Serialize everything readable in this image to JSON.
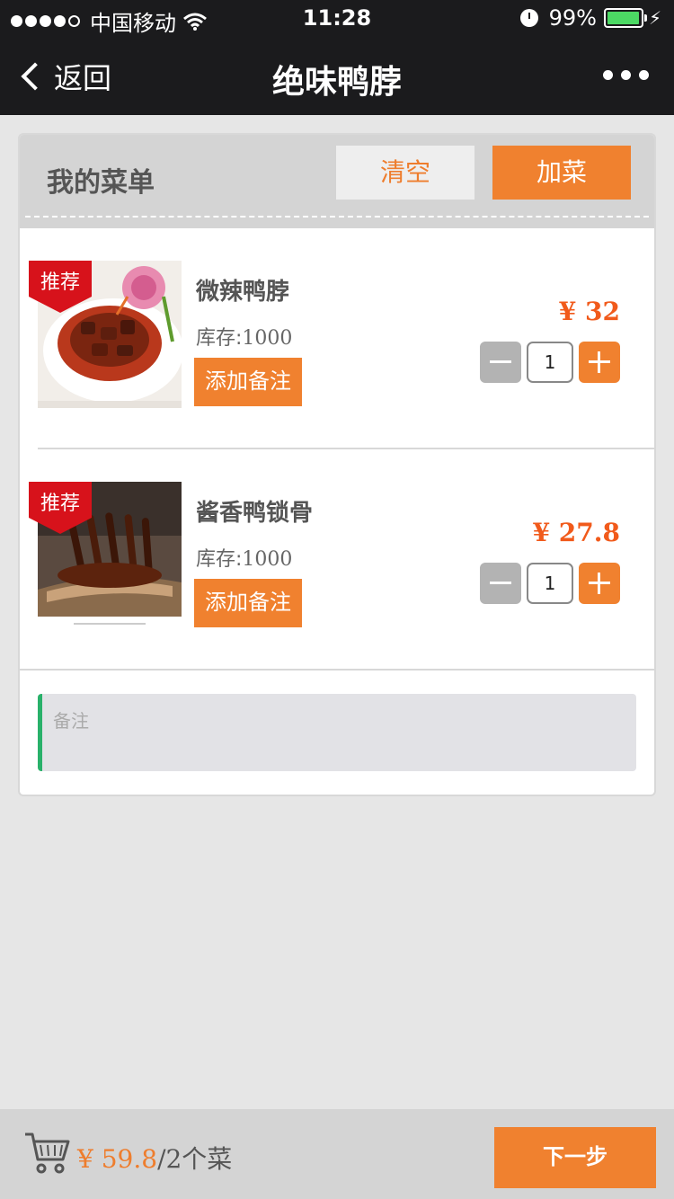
{
  "status_bar": {
    "carrier": "中国移动",
    "time": "11:28",
    "battery": "99%"
  },
  "nav": {
    "back_label": "返回",
    "title": "绝味鸭脖"
  },
  "menu": {
    "title": "我的菜单",
    "clear_label": "清空",
    "add_label": "加菜",
    "items": [
      {
        "badge": "推荐",
        "name": "微辣鸭脖",
        "stock_label": "库存:",
        "stock": "1000",
        "note_button": "添加备注",
        "price": "¥ 32",
        "quantity": "1"
      },
      {
        "badge": "推荐",
        "name": "酱香鸭锁骨",
        "stock_label": "库存:",
        "stock": "1000",
        "note_button": "添加备注",
        "price": "¥ 27.8",
        "quantity": "1"
      }
    ],
    "remark_placeholder": "备注"
  },
  "footer": {
    "total_amount": "¥ 59.8",
    "count_text": "/2个菜",
    "next_label": "下一步"
  },
  "colors": {
    "accent": "#f0812f",
    "price": "#f15a1b",
    "badge": "#d7121b",
    "remark_border": "#29b16a"
  }
}
